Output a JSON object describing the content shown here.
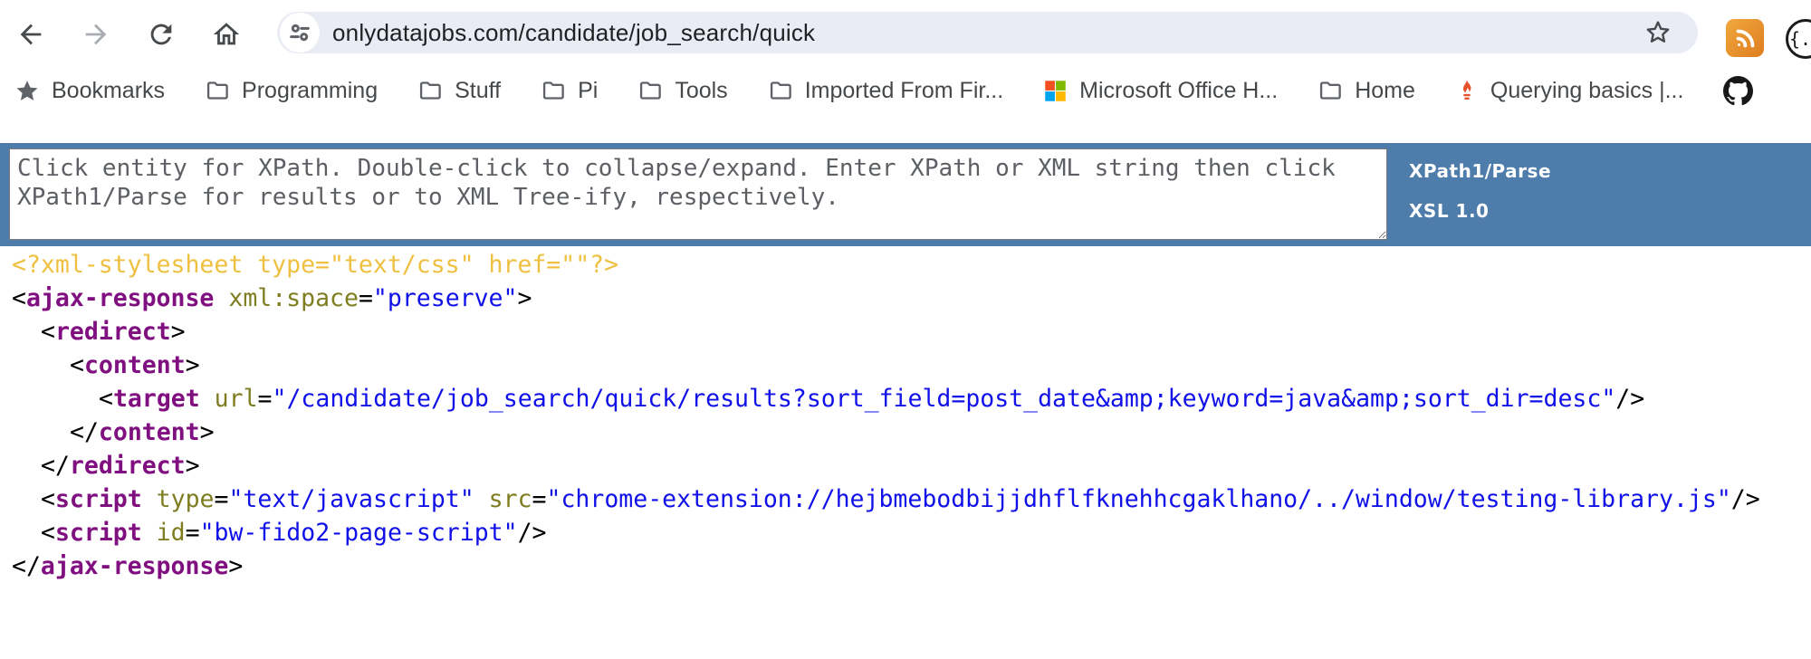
{
  "toolbar": {
    "url": "onlydatajobs.com/candidate/job_search/quick"
  },
  "bookmarks_bar": {
    "items": [
      {
        "name": "bookmarks",
        "icon": "star-icon",
        "label": "Bookmarks"
      },
      {
        "name": "programming",
        "icon": "folder-icon",
        "label": "Programming"
      },
      {
        "name": "stuff",
        "icon": "folder-icon",
        "label": "Stuff"
      },
      {
        "name": "pi",
        "icon": "folder-icon",
        "label": "Pi"
      },
      {
        "name": "tools",
        "icon": "folder-icon",
        "label": "Tools"
      },
      {
        "name": "imported-from-firefox",
        "icon": "folder-icon",
        "label": "Imported From Fir..."
      },
      {
        "name": "microsoft-office",
        "icon": "microsoft-logo-icon",
        "label": "Microsoft Office H..."
      },
      {
        "name": "home",
        "icon": "folder-icon",
        "label": "Home"
      },
      {
        "name": "querying-basics",
        "icon": "prometheus-torch-icon",
        "label": "Querying basics |..."
      },
      {
        "name": "github",
        "icon": "github-icon",
        "label": ""
      }
    ]
  },
  "xpath_panel": {
    "instructions_placeholder": "Click entity for XPath. Double-click to collapse/expand. Enter XPath or XML string then click\nXPath1/Parse for results or to XML Tree-ify, respectively.",
    "parse_button_label": "XPath1/Parse",
    "xsl_button_label": "XSL 1.0",
    "background_color": "#4e7cab"
  },
  "xml_tree": {
    "colors": {
      "pi": "#efc040",
      "tag": "#800f80",
      "attr": "#7e7d20",
      "value": "#1010e8",
      "punctuation": "#000000"
    },
    "lines": [
      {
        "indent": 0,
        "tokens": [
          [
            "pi",
            "<?xml-stylesheet type=\"text/css\" href=\"\"?>"
          ]
        ]
      },
      {
        "indent": 0,
        "tokens": [
          [
            "p",
            "<"
          ],
          [
            "t",
            "ajax-response"
          ],
          [
            "p",
            " "
          ],
          [
            "a",
            "xml:space"
          ],
          [
            "p",
            "="
          ],
          [
            "v",
            "\"preserve\""
          ],
          [
            "p",
            ">"
          ]
        ]
      },
      {
        "indent": 1,
        "tokens": [
          [
            "p",
            "<"
          ],
          [
            "t",
            "redirect"
          ],
          [
            "p",
            ">"
          ]
        ]
      },
      {
        "indent": 2,
        "tokens": [
          [
            "p",
            "<"
          ],
          [
            "t",
            "content"
          ],
          [
            "p",
            ">"
          ]
        ]
      },
      {
        "indent": 3,
        "tokens": [
          [
            "p",
            "<"
          ],
          [
            "t",
            "target"
          ],
          [
            "p",
            " "
          ],
          [
            "a",
            "url"
          ],
          [
            "p",
            "="
          ],
          [
            "v",
            "\"/candidate/job_search/quick/results?sort_field=post_date&amp;keyword=java&amp;sort_dir=desc\""
          ],
          [
            "p",
            "/>"
          ]
        ]
      },
      {
        "indent": 2,
        "tokens": [
          [
            "p",
            "</"
          ],
          [
            "t",
            "content"
          ],
          [
            "p",
            ">"
          ]
        ]
      },
      {
        "indent": 1,
        "tokens": [
          [
            "p",
            "</"
          ],
          [
            "t",
            "redirect"
          ],
          [
            "p",
            ">"
          ]
        ]
      },
      {
        "indent": 1,
        "tokens": [
          [
            "p",
            "<"
          ],
          [
            "t",
            "script"
          ],
          [
            "p",
            " "
          ],
          [
            "a",
            "type"
          ],
          [
            "p",
            "="
          ],
          [
            "v",
            "\"text/javascript\""
          ],
          [
            "p",
            " "
          ],
          [
            "a",
            "src"
          ],
          [
            "p",
            "="
          ],
          [
            "v",
            "\"chrome-extension://hejbmebodbijjdhflfknehhcgaklhano/../window/testing-library.js\""
          ],
          [
            "p",
            "/>"
          ]
        ]
      },
      {
        "indent": 1,
        "tokens": [
          [
            "p",
            "<"
          ],
          [
            "t",
            "script"
          ],
          [
            "p",
            " "
          ],
          [
            "a",
            "id"
          ],
          [
            "p",
            "="
          ],
          [
            "v",
            "\"bw-fido2-page-script\""
          ],
          [
            "p",
            "/>"
          ]
        ]
      },
      {
        "indent": 0,
        "tokens": [
          [
            "p",
            "</"
          ],
          [
            "t",
            "ajax-response"
          ],
          [
            "p",
            ">"
          ]
        ]
      }
    ]
  }
}
